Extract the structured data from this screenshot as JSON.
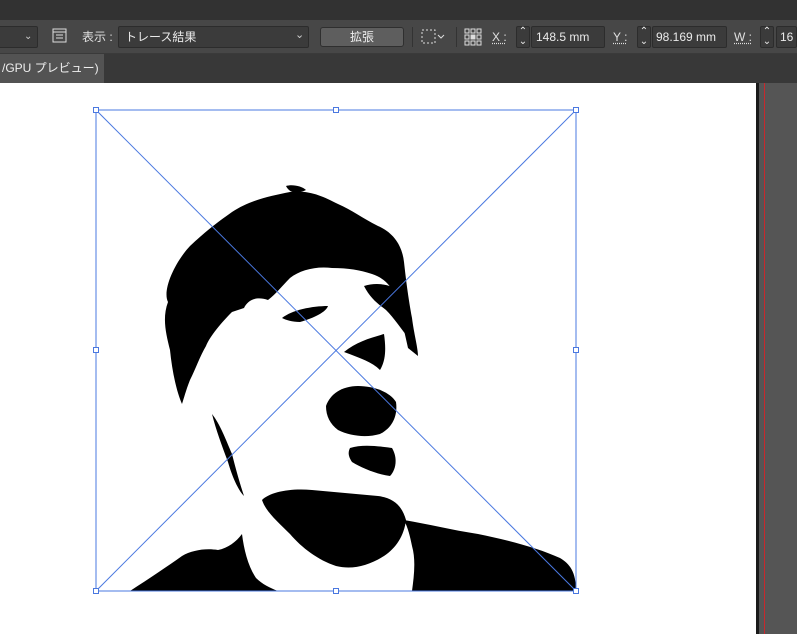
{
  "control_bar": {
    "view_label": "表示 :",
    "view_value": "トレース結果",
    "expand_button": "拡張",
    "x_label": "X :",
    "x_value": "148.5 mm",
    "y_label": "Y :",
    "y_value": "98.169 mm",
    "w_label": "W :",
    "w_value": "16"
  },
  "document_tab": {
    "label": "/GPU プレビュー)"
  },
  "colors": {
    "selection": "#4a78e0",
    "guide": "#c8282d"
  }
}
